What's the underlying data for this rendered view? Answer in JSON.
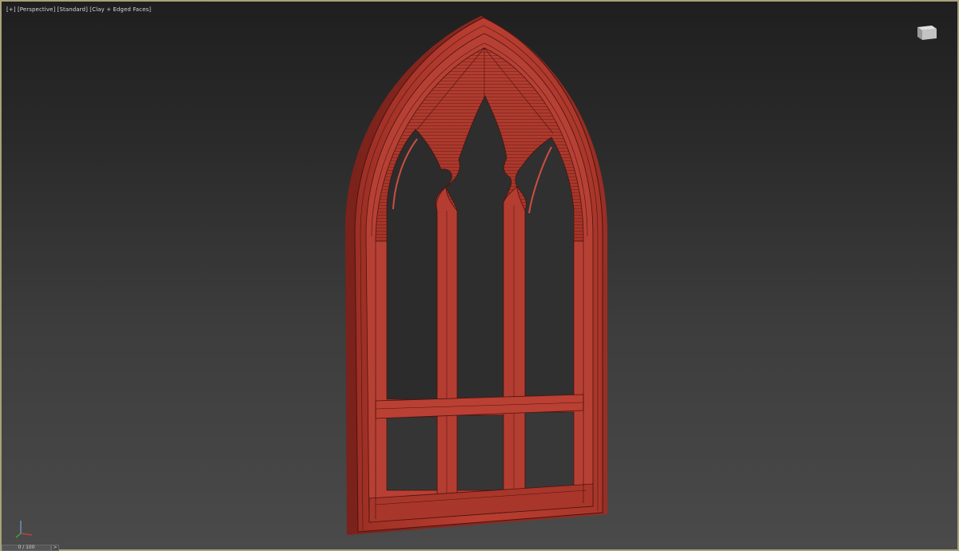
{
  "viewport": {
    "label_plus": "[+]",
    "label_view": "[Perspective]",
    "label_shading": "[Standard]",
    "label_display": "[Clay + Edged Faces]"
  },
  "timeline": {
    "frame_readout": "0 / 100",
    "next_arrow": ">"
  },
  "colors": {
    "frame_main": "#b23b2f",
    "frame_dark": "#7e231c",
    "frame_light": "#cc4e40",
    "edge_lines": "#4a1410",
    "viewport_border": "#a8a27a"
  },
  "icons": {
    "viewcube": "viewcube-icon",
    "axis": "axis-gizmo-icon"
  }
}
